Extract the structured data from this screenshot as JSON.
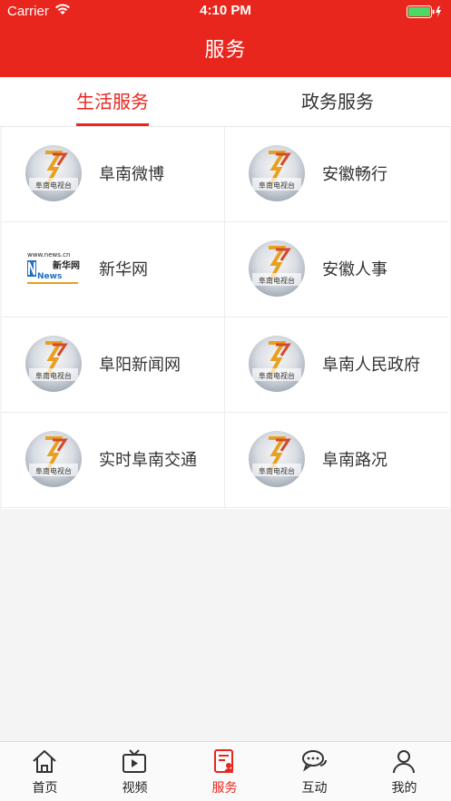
{
  "status_bar": {
    "carrier": "Carrier",
    "time": "4:10 PM"
  },
  "navbar": {
    "title": "服务"
  },
  "tabs": [
    {
      "label": "生活服务",
      "active": true
    },
    {
      "label": "政务服务",
      "active": false
    }
  ],
  "services": [
    {
      "label": "阜南微博",
      "icon": "tv-station-logo"
    },
    {
      "label": "安徽畅行",
      "icon": "tv-station-logo"
    },
    {
      "label": "新华网",
      "icon": "xinhua-news-logo"
    },
    {
      "label": "安徽人事",
      "icon": "tv-station-logo"
    },
    {
      "label": "阜阳新闻网",
      "icon": "tv-station-logo"
    },
    {
      "label": "阜南人民政府",
      "icon": "tv-station-logo"
    },
    {
      "label": "实时阜南交通",
      "icon": "tv-station-logo"
    },
    {
      "label": "阜南路况",
      "icon": "tv-station-logo"
    }
  ],
  "logo_text": {
    "station": "阜南电视台",
    "xinhua_url": "www.news.cn",
    "xinhua_cn": "新华网",
    "xinhua_news": "News"
  },
  "tabbar": [
    {
      "label": "首页",
      "icon": "home-icon",
      "active": false
    },
    {
      "label": "视频",
      "icon": "tv-icon",
      "active": false
    },
    {
      "label": "服务",
      "icon": "document-user-icon",
      "active": true
    },
    {
      "label": "互动",
      "icon": "chat-bubble-icon",
      "active": false
    },
    {
      "label": "我的",
      "icon": "person-icon",
      "active": false
    }
  ],
  "colors": {
    "accent": "#e8261d",
    "background": "#f4f4f4"
  }
}
